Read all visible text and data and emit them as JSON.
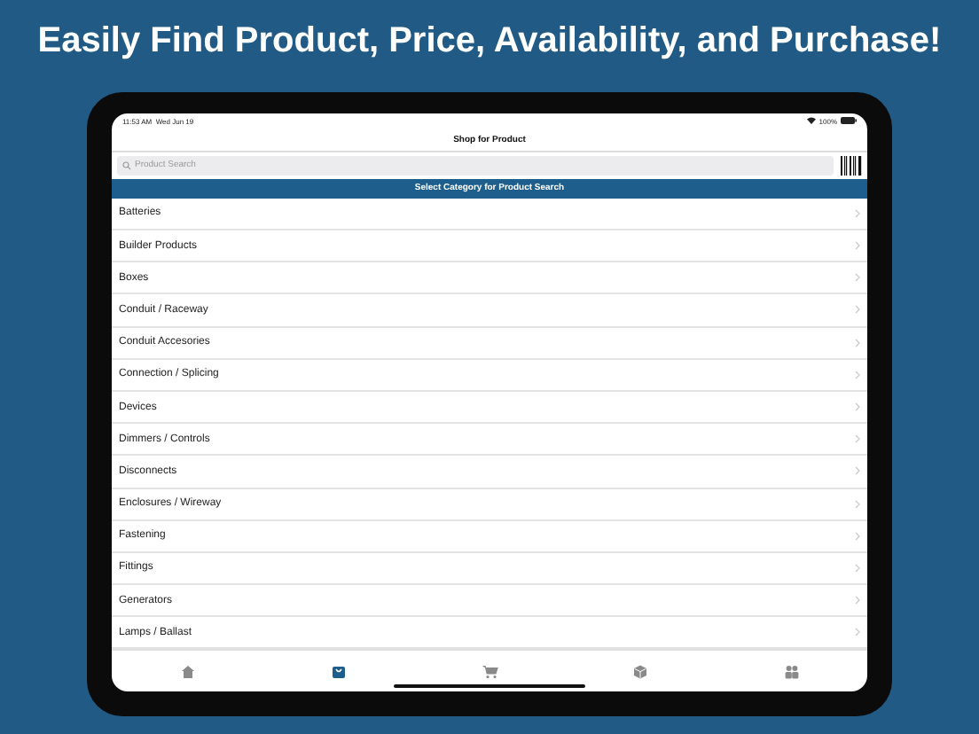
{
  "headline": "Easily Find Product, Price, Availability, and Purchase!",
  "status_bar": {
    "time": "11:53 AM",
    "date": "Wed Jun 19",
    "battery": "100%"
  },
  "nav_title": "Shop for Product",
  "search": {
    "placeholder": "Product Search"
  },
  "section_header": "Select Category for Product Search",
  "categories": [
    "Batteries",
    "Builder Products",
    "Boxes",
    "Conduit / Raceway",
    "Conduit Accesories",
    "Connection / Splicing",
    "Devices",
    "Dimmers / Controls",
    "Disconnects",
    "Enclosures / Wireway",
    "Fastening",
    "Fittings",
    "Generators",
    "Lamps / Ballast"
  ],
  "tabs": [
    {
      "kind": "home",
      "selected": false
    },
    {
      "kind": "bag",
      "selected": true
    },
    {
      "kind": "cart",
      "selected": false
    },
    {
      "kind": "box",
      "selected": false
    },
    {
      "kind": "people",
      "selected": false
    }
  ]
}
